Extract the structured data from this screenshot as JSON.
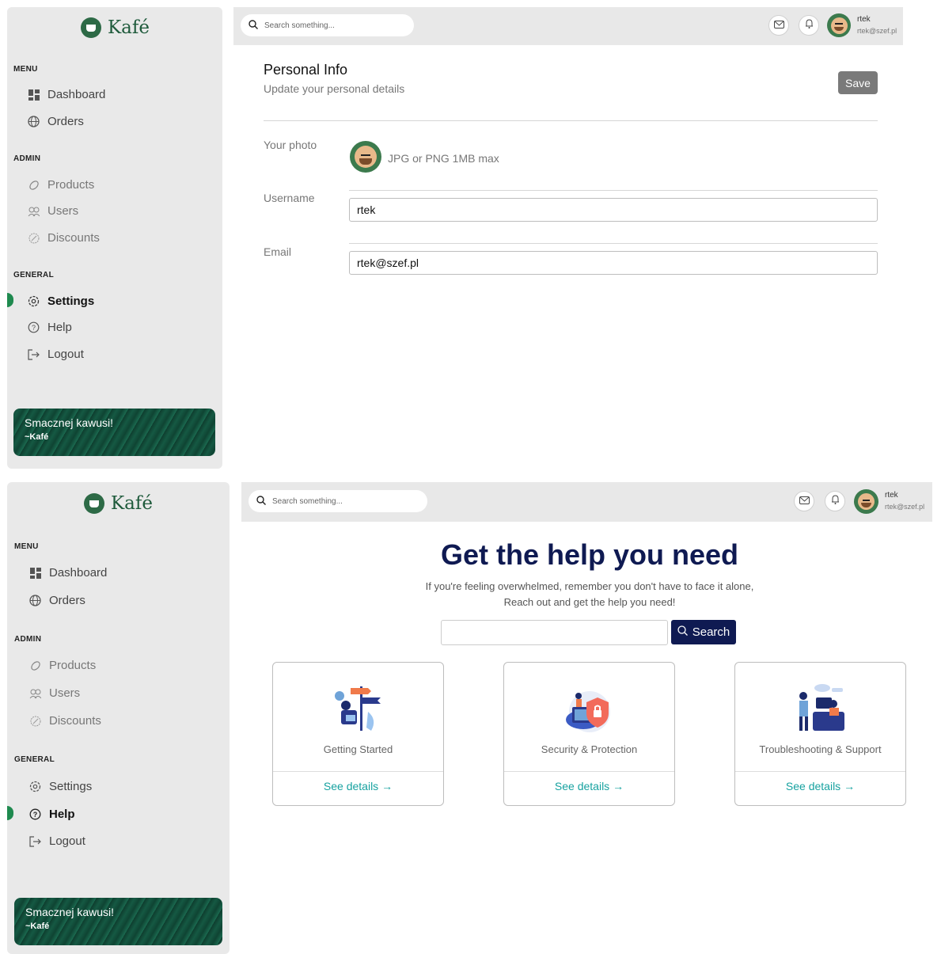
{
  "brand": {
    "name": "Kafé"
  },
  "search": {
    "placeholder": "Search something..."
  },
  "user": {
    "name": "rtek",
    "email": "rtek@szef.pl"
  },
  "sidebar": {
    "sections": {
      "menu": "MENU",
      "admin": "ADMIN",
      "general": "GENERAL"
    },
    "items": {
      "dashboard": "Dashboard",
      "orders": "Orders",
      "products": "Products",
      "users": "Users",
      "discounts": "Discounts",
      "settings": "Settings",
      "help": "Help",
      "logout": "Logout"
    },
    "promo": {
      "line1": "Smacznej kawusi!",
      "line2": "~Kafé"
    }
  },
  "settings_page": {
    "title": "Personal Info",
    "subtitle": "Update your personal details",
    "save_label": "Save",
    "photo_label": "Your photo",
    "photo_hint": "JPG or PNG 1MB max",
    "username_label": "Username",
    "username_value": "rtek",
    "email_label": "Email",
    "email_value": "rtek@szef.pl"
  },
  "help_page": {
    "title": "Get the help you need",
    "subtitle_line1": "If you're feeling overwhelmed, remember you don't have to face it alone,",
    "subtitle_line2": "Reach out and get the help you need!",
    "search_button": "Search",
    "cards": [
      {
        "title": "Getting Started",
        "link": "See details →"
      },
      {
        "title": "Security & Protection",
        "link": "See details →"
      },
      {
        "title": "Troubleshooting & Support",
        "link": "See details →"
      }
    ]
  },
  "colors": {
    "accent_green": "#1f8a4f",
    "navy": "#0f1a52",
    "teal_link": "#17a2a0"
  }
}
